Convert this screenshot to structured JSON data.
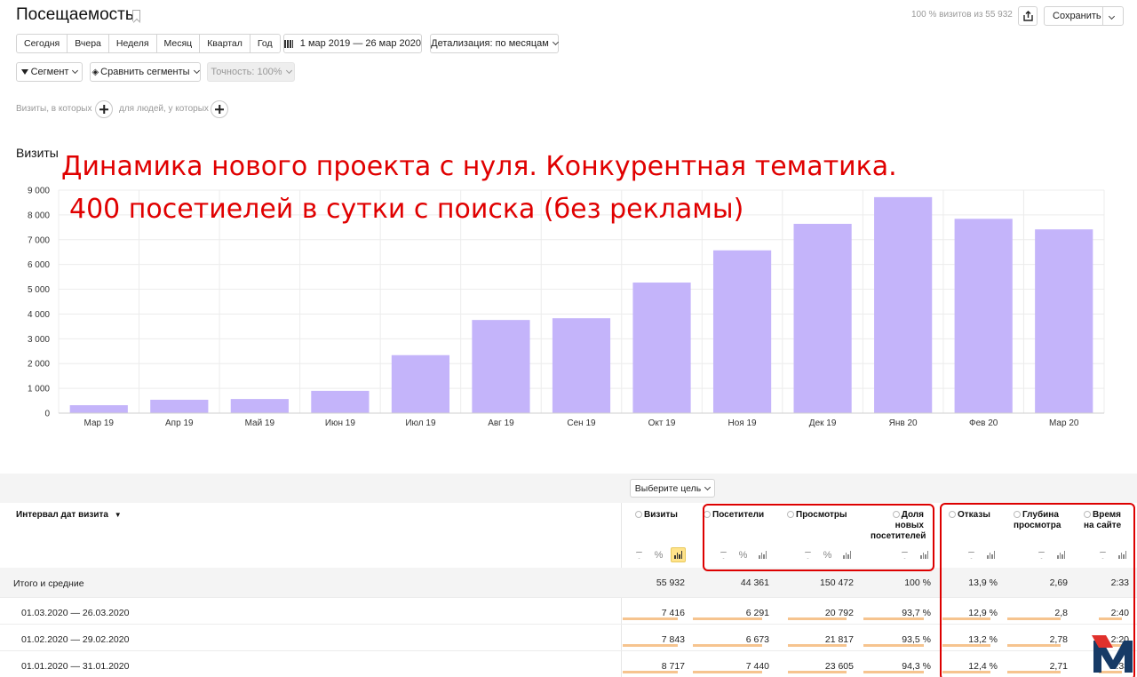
{
  "page": {
    "title": "Посещаемость",
    "visits_note": "100 % визитов из 55 932",
    "save_label": "Сохранить"
  },
  "periods": [
    "Сегодня",
    "Вчера",
    "Неделя",
    "Месяц",
    "Квартал",
    "Год"
  ],
  "date_range": "1 мар 2019 — 26 мар 2020",
  "detail_label": "Детализация: по месяцам",
  "segment_label": "Сегмент",
  "compare_label": "Сравнить сегменты",
  "accuracy_label": "Точность: 100%",
  "conditions": {
    "visits_where": "Визиты, в которых",
    "people_where": "для людей, у которых"
  },
  "chart_title": "Визиты",
  "overlay": {
    "line1": "Динамика нового проекта с нуля. Конкурентная тематика.",
    "line2": "400 посетиелей в сутки с поиска (без рекламы)"
  },
  "chart_data": {
    "type": "bar",
    "categories": [
      "Мар 19",
      "Апр 19",
      "Май 19",
      "Июн 19",
      "Июл 19",
      "Авг 19",
      "Сен 19",
      "Окт 19",
      "Ноя 19",
      "Дек 19",
      "Янв 20",
      "Фев 20",
      "Мар 20"
    ],
    "values": [
      320,
      540,
      570,
      900,
      2340,
      3760,
      3830,
      5270,
      6570,
      7640,
      8717,
      7843,
      7416
    ],
    "yticks": [
      "9 000",
      "8 000",
      "7 000",
      "6 000",
      "5 000",
      "4 000",
      "3 000",
      "2 000",
      "1 000",
      "0"
    ],
    "ylim": [
      0,
      9000
    ],
    "bar_color": "#c4b4fa",
    "grid": true
  },
  "table": {
    "goal_label": "Выберите цель",
    "dimension_header": "Интервал дат визита",
    "sort_marker": "▼",
    "columns": [
      {
        "key": "visits",
        "label": "Визиты"
      },
      {
        "key": "users",
        "label": "Посетители"
      },
      {
        "key": "views",
        "label": "Просмотры"
      },
      {
        "key": "new_share",
        "label": "Доля новых посетителей"
      },
      {
        "key": "bounce",
        "label": "Отказы"
      },
      {
        "key": "depth",
        "label": "Глубина просмотра"
      },
      {
        "key": "time",
        "label": "Время на сайте"
      }
    ],
    "total": {
      "label": "Итого и средние",
      "values": [
        "55 932",
        "44 361",
        "150 472",
        "100 %",
        "13,9 %",
        "2,69",
        "2:33"
      ]
    },
    "rows": [
      {
        "label": "01.03.2020 — 26.03.2020",
        "values": [
          "7 416",
          "6 291",
          "20 792",
          "93,7 %",
          "12,9 %",
          "2,8",
          "2:40"
        ]
      },
      {
        "label": "01.02.2020 — 29.02.2020",
        "values": [
          "7 843",
          "6 673",
          "21 817",
          "93,5 %",
          "13,2 %",
          "2,78",
          "2:20"
        ]
      },
      {
        "label": "01.01.2020 — 31.01.2020",
        "values": [
          "8 717",
          "7 440",
          "23 605",
          "94,3 %",
          "12,4 %",
          "2,71",
          "2:33"
        ]
      }
    ]
  },
  "colors": {
    "highlight": "#dd0000",
    "bar": "#c4b4fa",
    "underline": "#f6c48f",
    "logo": "#163a66"
  }
}
